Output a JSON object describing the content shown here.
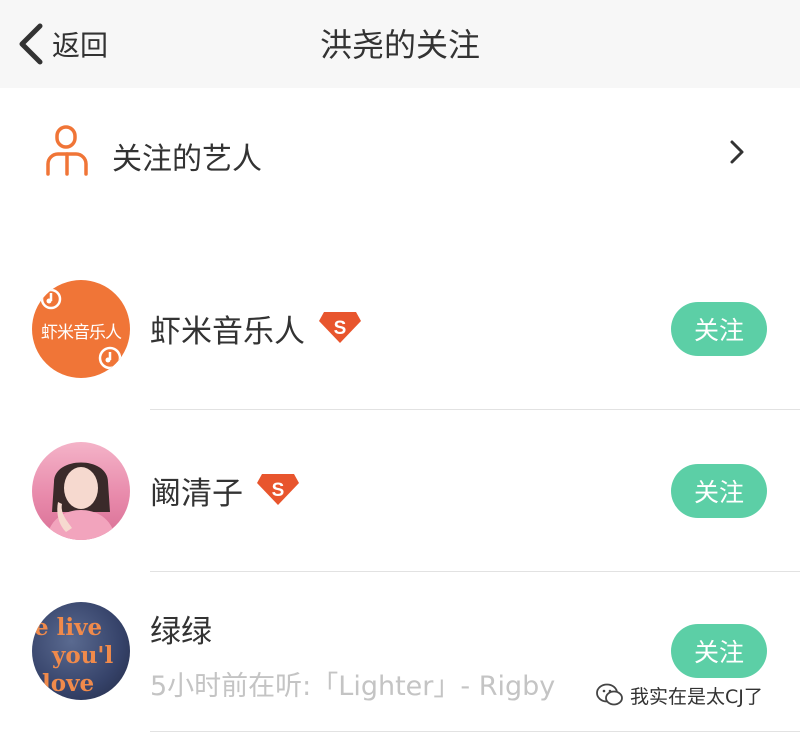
{
  "nav": {
    "back_label": "返回",
    "title": "洪尧的关注"
  },
  "artists": {
    "label": "关注的艺人"
  },
  "users": [
    {
      "name": "虾米音乐人",
      "vip": "S",
      "follow_label": "关注",
      "avatar_text": "虾米音乐人"
    },
    {
      "name": "阚清子",
      "vip": "S",
      "follow_label": "关注"
    },
    {
      "name": "绿绿",
      "follow_label": "关注",
      "status": "5小时前在听:「Lighter」- Rigby",
      "avatar_words": [
        "e live",
        "you'l",
        "love"
      ]
    }
  ],
  "watermark": {
    "text": "我实在是太CJ了"
  },
  "colors": {
    "accent": "#f07537",
    "follow_green": "#5ccfa6",
    "vip_orange": "#e8552d"
  }
}
